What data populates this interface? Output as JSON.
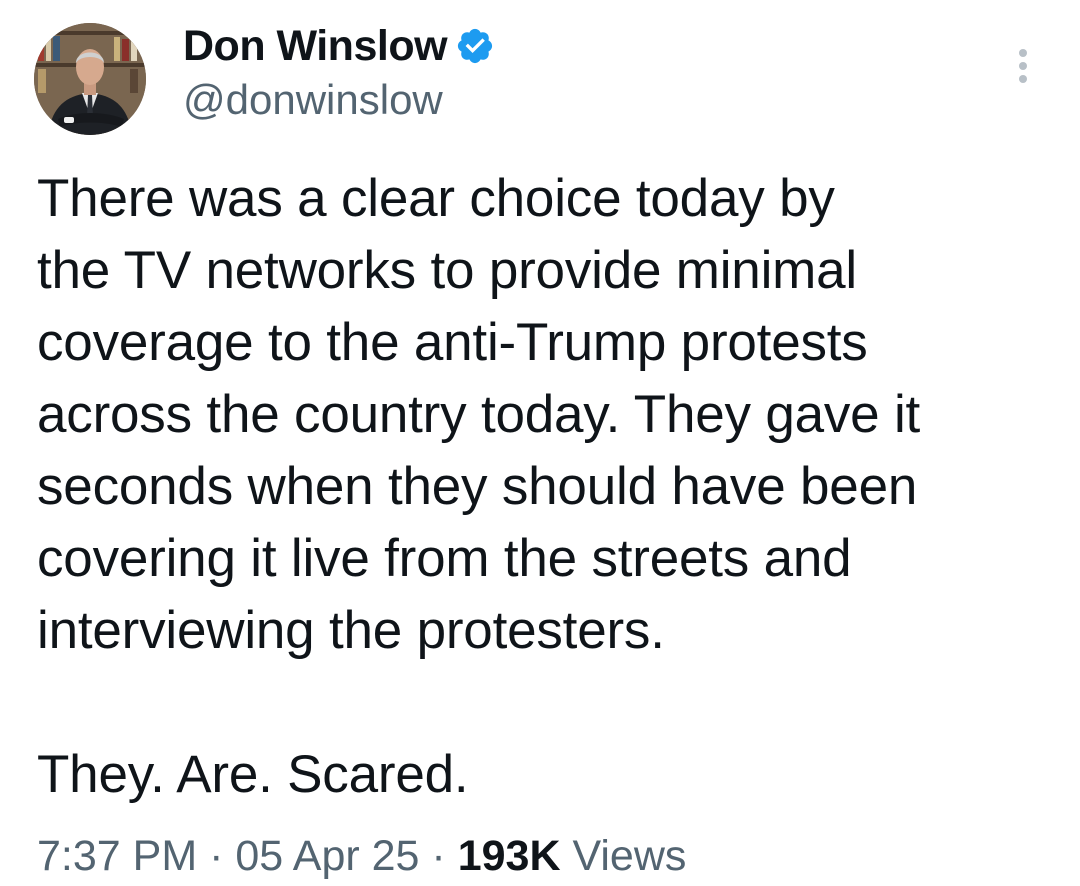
{
  "author": {
    "display_name": "Don Winslow",
    "handle": "@donwinslow",
    "verified": true,
    "verified_color": "#1d9bf0"
  },
  "tweet": {
    "text": "There was a clear choice today by\nthe TV networks to provide minimal\ncoverage to the anti-Trump protests\nacross the country today. They gave it\nseconds when they should have been\ncovering it live from the streets and\ninterviewing the protesters.\n\nThey. Are. Scared.",
    "time": "7:37 PM",
    "separator": "·",
    "date": "05 Apr 25",
    "views_count": "193K",
    "views_label": "Views"
  },
  "icons": {
    "more": "more-vertical-icon",
    "verified": "verified-badge-icon"
  }
}
